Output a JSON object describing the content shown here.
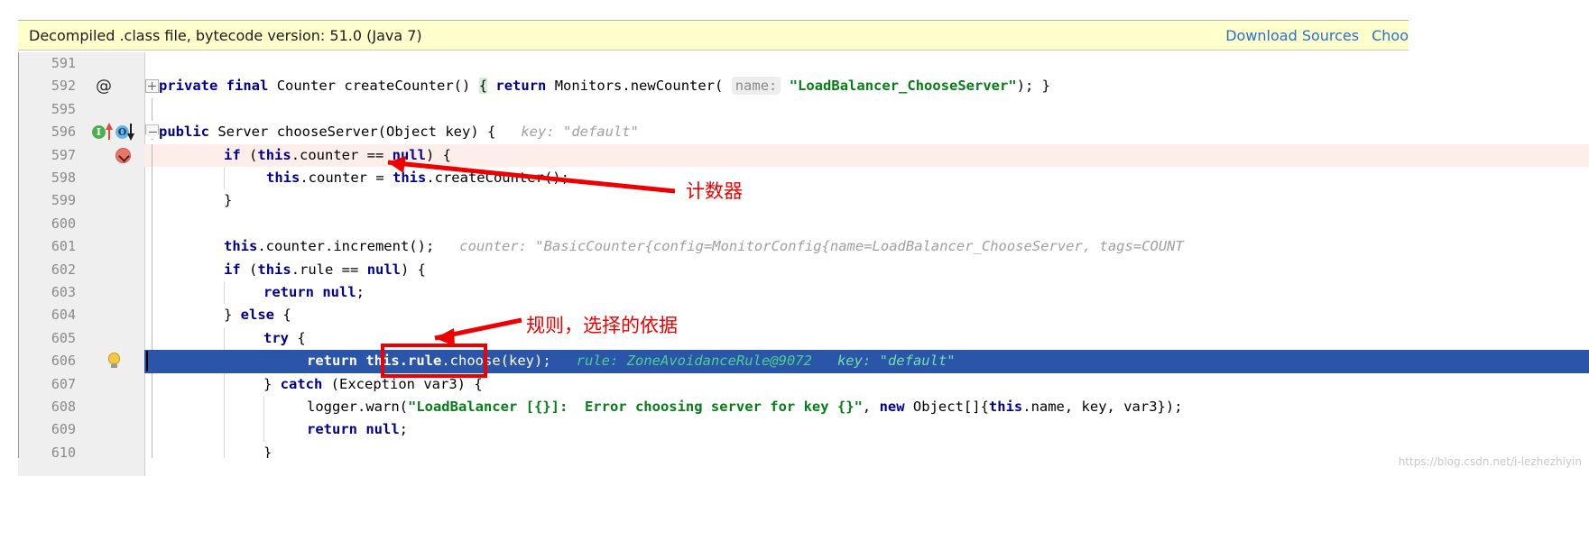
{
  "banner": {
    "message": "Decompiled .class file, bytecode version: 51.0 (Java 7)",
    "download_sources_label": "Download Sources",
    "choose_sources_label": "Choo",
    "background_color": "#ffffcc",
    "link_color": "#2a6fc9"
  },
  "editor": {
    "selected_line_number": "606",
    "selection_color": "#2b55a8",
    "breakpoint_line_color": "#fdeeea",
    "lines": [
      {
        "no": "591",
        "code": ""
      },
      {
        "no": "592",
        "code": "    private final Counter createCounter() { return Monitors.newCounter( name: \"LoadBalancer_ChooseServer\"); }"
      },
      {
        "no": "595",
        "code": ""
      },
      {
        "no": "596",
        "code": "    public Server chooseServer(Object key) {   key: \"default\""
      },
      {
        "no": "597",
        "code": "        if (this.counter == null) {"
      },
      {
        "no": "598",
        "code": "            this.counter = this.createCounter();"
      },
      {
        "no": "599",
        "code": "        }"
      },
      {
        "no": "600",
        "code": ""
      },
      {
        "no": "601",
        "code": "        this.counter.increment();   counter: \"BasicCounter{config=MonitorConfig{name=LoadBalancer_ChooseServer, tags=COUNT"
      },
      {
        "no": "602",
        "code": "        if (this.rule == null) {"
      },
      {
        "no": "603",
        "code": "            return null;"
      },
      {
        "no": "604",
        "code": "        } else {"
      },
      {
        "no": "605",
        "code": "            try {"
      },
      {
        "no": "606",
        "code": "                return this.rule.choose(key);   rule: ZoneAvoidanceRule@9072   key: \"default\""
      },
      {
        "no": "607",
        "code": "            } catch (Exception var3) {"
      },
      {
        "no": "608",
        "code": "                logger.warn(\"LoadBalancer [{}]:  Error choosing server for key {}\", new Object[]{this.name, key, var3});"
      },
      {
        "no": "609",
        "code": "                return null;"
      },
      {
        "no": "610",
        "code": "            }"
      }
    ],
    "tokens": {
      "line592": {
        "kw_private": "private",
        "kw_final": "final",
        "type_counter": "Counter",
        "method": "createCounter()",
        "brace_open": "{",
        "kw_return": "return",
        "call": "Monitors.newCounter(",
        "param_hint": "name:",
        "string": "\"LoadBalancer_ChooseServer\"",
        "tail": "); }"
      },
      "line596": {
        "kw_public": "public",
        "type_server": "Server",
        "method": "chooseServer(Object key) {",
        "hint": "key: \"default\""
      },
      "line597": {
        "kw_if": "if",
        "rest": "(",
        "kw_this": "this",
        "field": ".counter == ",
        "kw_null": "null",
        "tail": ") {"
      },
      "line598": {
        "kw_this1": "this",
        "mid": ".counter = ",
        "kw_this2": "this",
        "tail": ".createCounter();"
      },
      "line599": {
        "text": "}"
      },
      "line601": {
        "kw_this": "this",
        "call": ".counter.increment();",
        "hint": "counter: \"BasicCounter{config=MonitorConfig{name=LoadBalancer_ChooseServer, tags=COUNT"
      },
      "line602": {
        "kw_if": "if",
        "open": "(",
        "kw_this": "this",
        "field": ".rule == ",
        "kw_null": "null",
        "tail": ") {"
      },
      "line603": {
        "kw_return": "return",
        "kw_null": "null",
        "tail": ";"
      },
      "line604": {
        "close": "} ",
        "kw_else": "else",
        "open": " {"
      },
      "line605": {
        "kw_try": "try",
        "open": " {"
      },
      "line606": {
        "kw_return": "return",
        "boxed": "this.rule",
        "call": ".choose(key);",
        "hint_rule": "rule: ZoneAvoidanceRule@9072",
        "hint_key": "key: \"default\""
      },
      "line607": {
        "close": "} ",
        "kw_catch": "catch",
        "tail": " (Exception var3) {"
      },
      "line608": {
        "call": "logger.warn(",
        "string": "\"LoadBalancer [{}]:  Error choosing server for key {}\"",
        "mid": ", ",
        "kw_new": "new",
        "arr": " Object[]{",
        "kw_this": "this",
        "tail": ".name, key, var3});"
      },
      "line609": {
        "kw_return": "return",
        "kw_null": "null",
        "tail": ";"
      },
      "line610": {
        "text": "}"
      }
    },
    "gutter_icons": {
      "line592_annotation": "at-sign-icon",
      "line596_implemented": "I",
      "line596_overridden": "O",
      "line597_breakpoint": "breakpoint-disabled-icon",
      "line606_intention": "lightbulb-icon"
    }
  },
  "annotations": [
    {
      "id": "counter-note",
      "text": "计数器",
      "color": "#ee0000"
    },
    {
      "id": "rule-note",
      "text": "规则，选择的依据",
      "color": "#ee0000"
    }
  ],
  "watermark": {
    "text": "https://blog.csdn.net/i-lezhezhiyin"
  }
}
